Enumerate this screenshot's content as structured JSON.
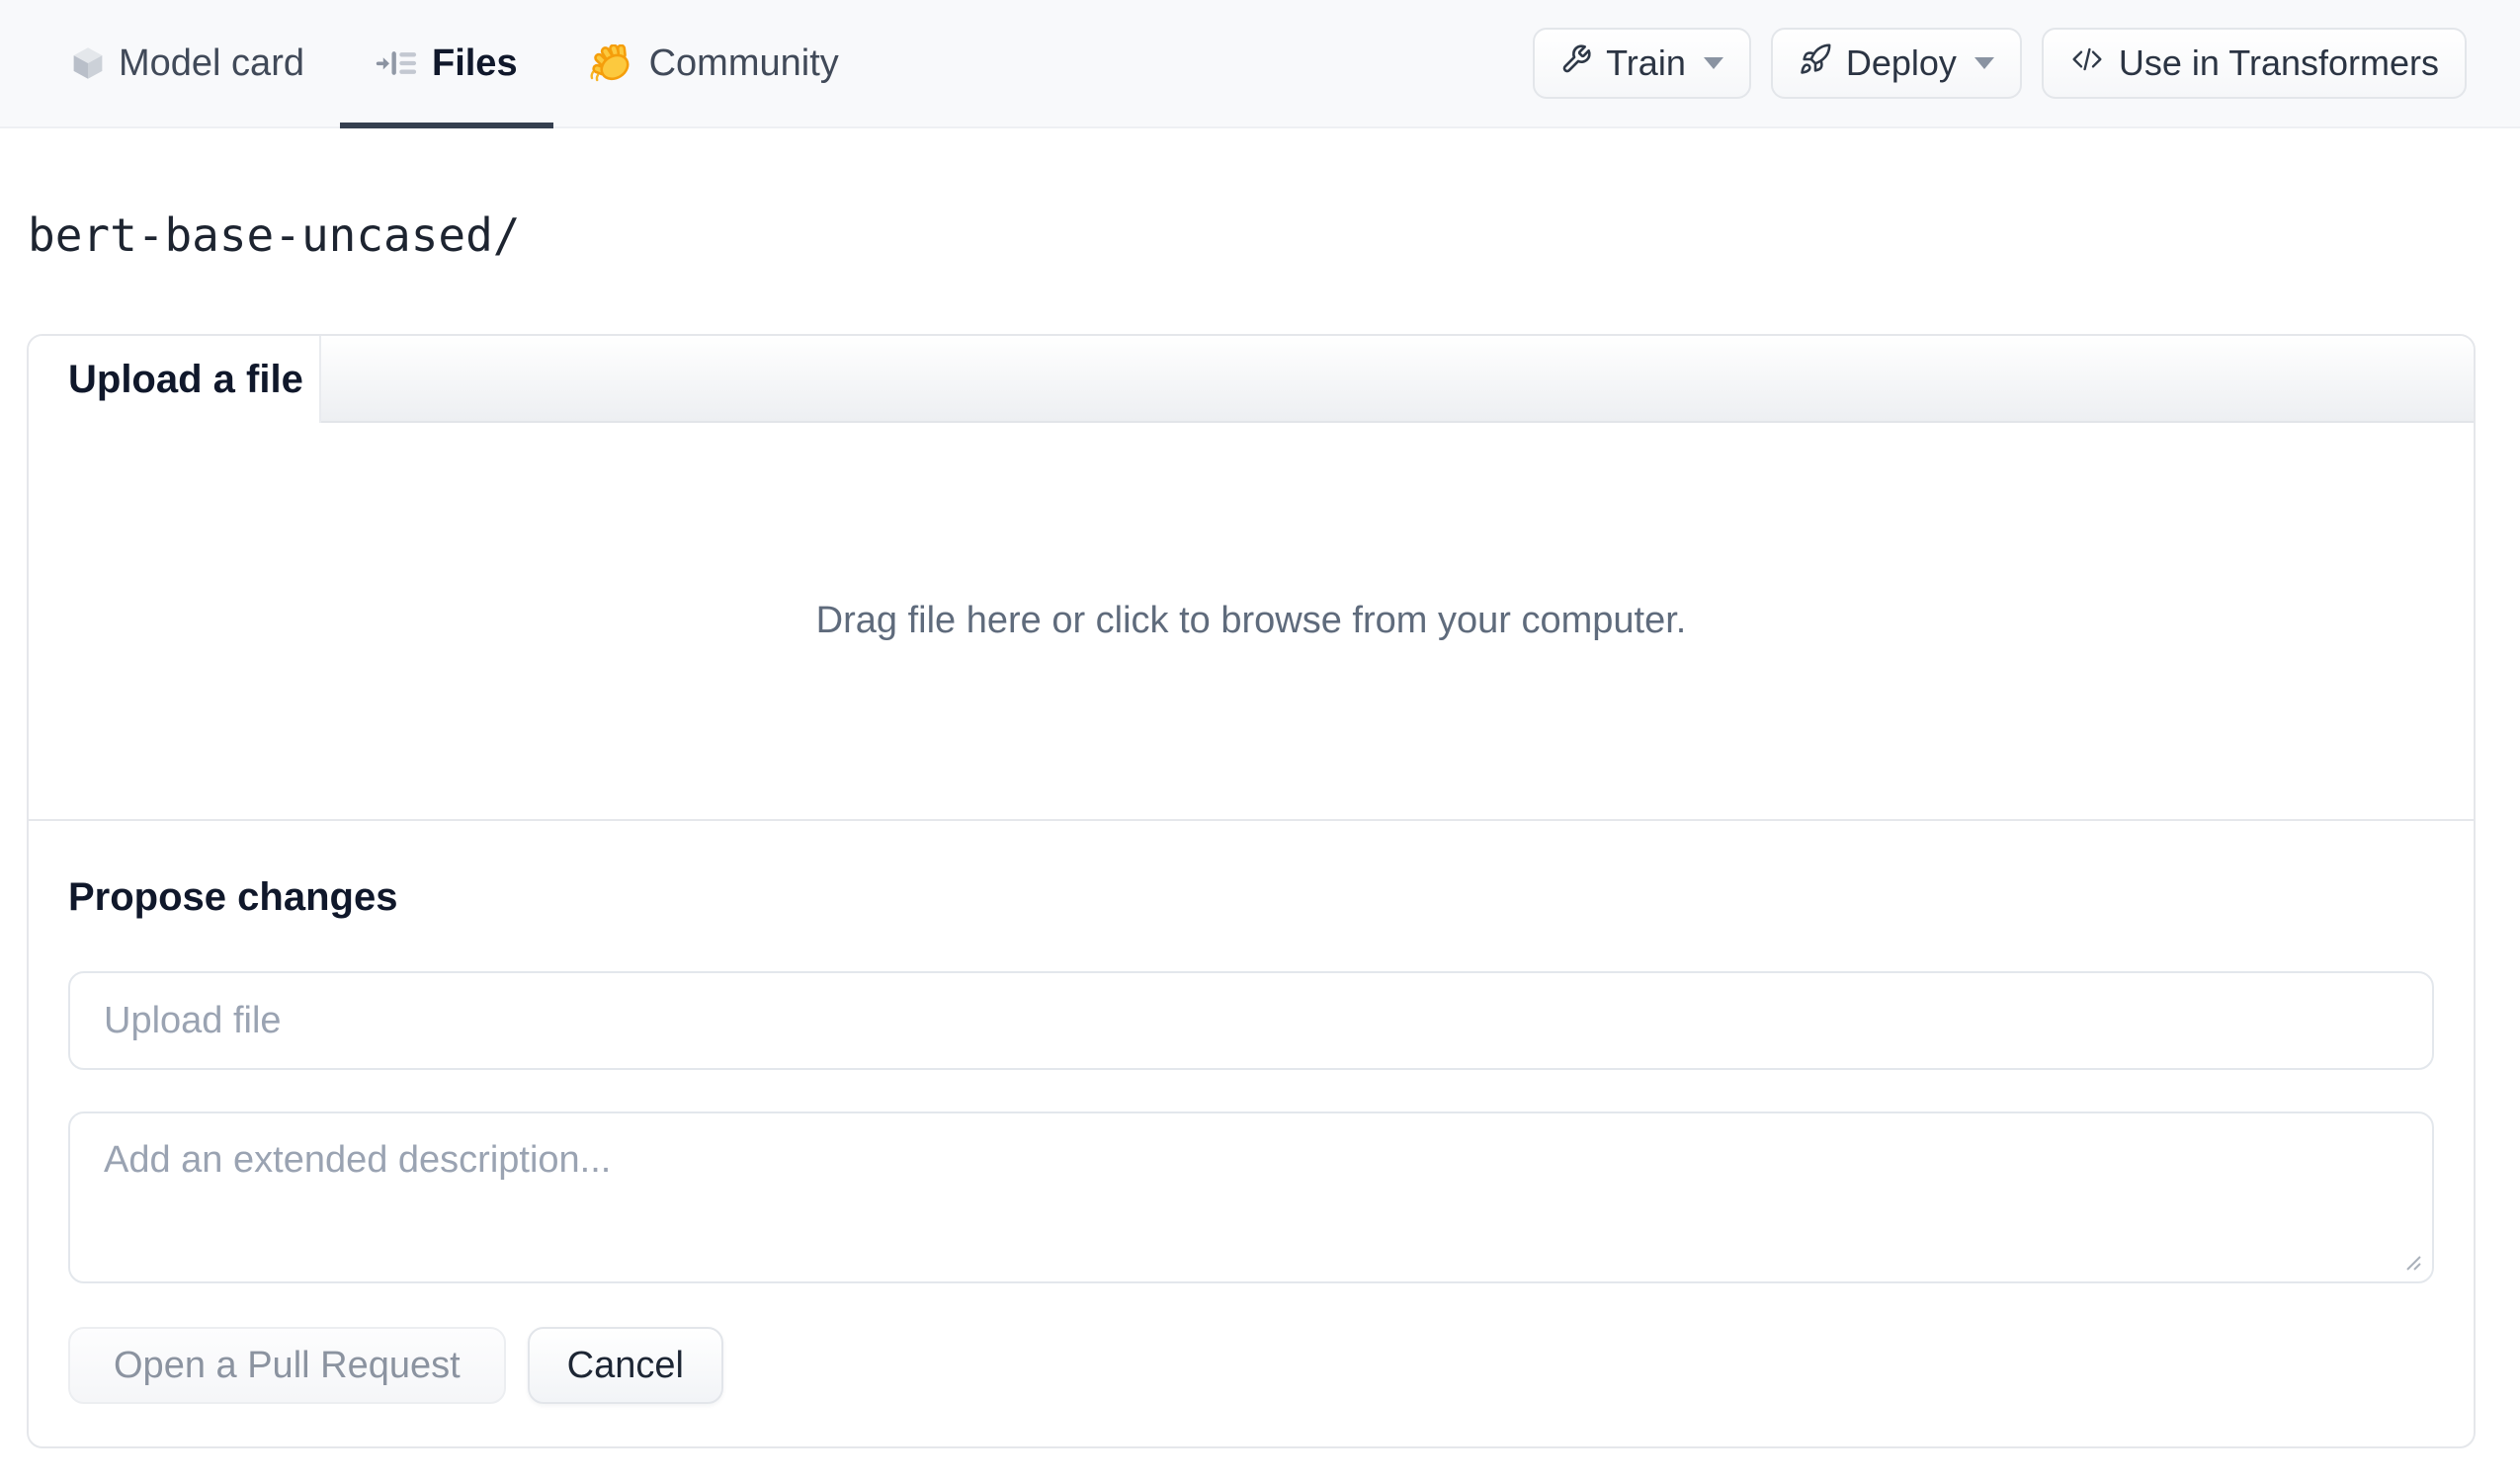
{
  "nav": {
    "tabs": [
      {
        "label": "Model card",
        "icon": "cube-icon",
        "active": false
      },
      {
        "label": "Files",
        "icon": "file-list-icon",
        "active": true
      },
      {
        "label": "Community",
        "icon": "waving-hand-icon",
        "active": false
      }
    ],
    "actions": [
      {
        "label": "Train",
        "icon": "wrench-icon",
        "has_dropdown": true
      },
      {
        "label": "Deploy",
        "icon": "rocket-icon",
        "has_dropdown": true
      },
      {
        "label": "Use in Transformers",
        "icon": "code-icon",
        "has_dropdown": false
      }
    ]
  },
  "breadcrumb": {
    "path": "bert-base-uncased/"
  },
  "upload_card": {
    "tab_label": "Upload a file",
    "dropzone_text": "Drag file here or click to browse from your computer.",
    "propose": {
      "heading": "Propose changes",
      "file_input": {
        "value": "",
        "placeholder": "Upload file"
      },
      "description_input": {
        "value": "",
        "placeholder": "Add an extended description..."
      },
      "submit_label": "Open a Pull Request",
      "cancel_label": "Cancel"
    }
  },
  "colors": {
    "nav_bg": "#f8f9fb",
    "active_tab_underline": "#353f4f",
    "card_border": "#e5e7eb",
    "muted_text": "#5f6b7c",
    "placeholder_text": "#9aa3b2",
    "hand_fill": "#fcc93e",
    "hand_stroke": "#f59e0b"
  }
}
